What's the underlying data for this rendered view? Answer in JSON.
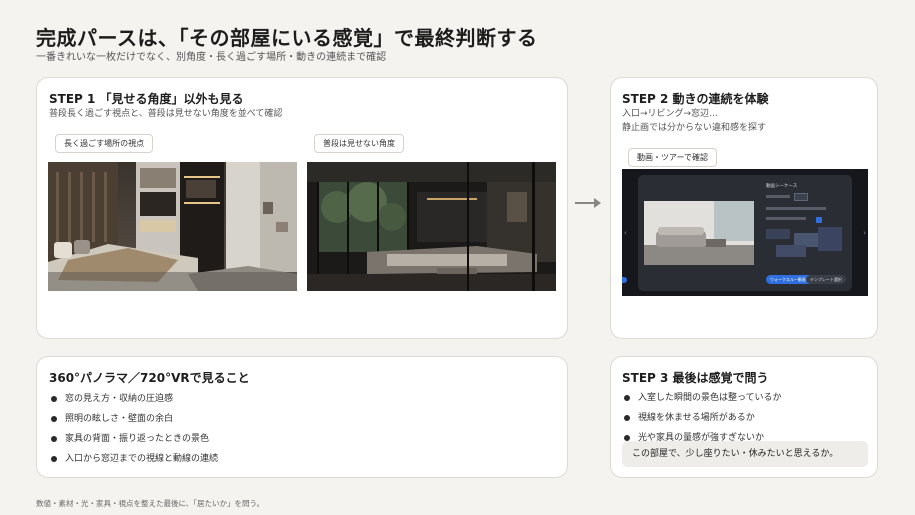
{
  "header": {
    "title": "完成パースは、「その部屋にいる感覚」で最終判断する",
    "subtitle": "一番きれいな一枚だけでなく、別角度・長く過ごす場所・動きの連続まで確認"
  },
  "step1": {
    "title": "STEP 1 「見せる角度」以外も見る",
    "desc": "普段長く過ごす視点と、普段は見せない角度を並べて確認",
    "image1_label": "長く過ごす場所の視点",
    "image2_label": "普段は見せない角度"
  },
  "step2": {
    "title": "STEP 2 動きの連続を体験",
    "desc_line1": "入口→リビング→窓辺…",
    "desc_line2": "静止画では分からない違和感を探す",
    "pill": "動画・ツアーで確認",
    "screen": {
      "panel_title": "動画シーケース",
      "button1": "ウォークスルー動画作成",
      "button2": "テンプレート選択"
    }
  },
  "vr": {
    "title": "360°パノラマ／720°VRで見ること",
    "items": [
      "窓の見え方・収納の圧迫感",
      "照明の眩しさ・壁面の余白",
      "家具の背面・振り返ったときの景色",
      "入口から窓辺までの視線と動線の連続"
    ]
  },
  "step3": {
    "title": "STEP 3 最後は感覚で問う",
    "items": [
      "入室した瞬間の景色は整っているか",
      "視線を休ませる場所があるか",
      "光や家具の量感が強すぎないか"
    ],
    "callout": "この部屋で、少し座りたい・休みたいと思えるか。"
  },
  "footer": {
    "note": "数値・素材・光・家具・視点を整えた最後に、「居たいか」を問う。"
  },
  "colors": {
    "background": "#f4f3f0",
    "card": "#ffffff",
    "accent_blue": "#2f6fe0",
    "text": "#1d1d1d"
  }
}
